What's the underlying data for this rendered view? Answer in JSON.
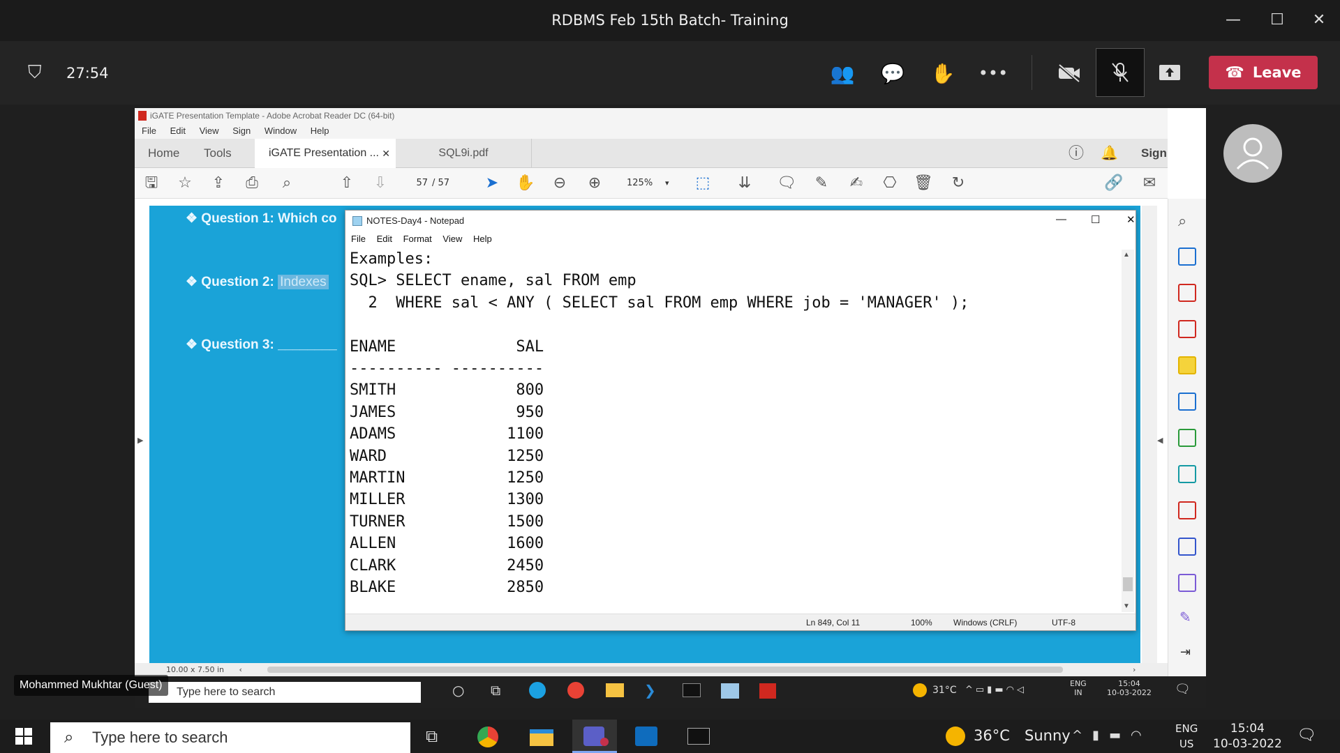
{
  "teams": {
    "window_title": "RDBMS Feb 15th Batch- Training",
    "timer": "27:54",
    "leave_label": "Leave"
  },
  "acrobat": {
    "title": "iGATE Presentation Template - Adobe Acrobat Reader DC (64-bit)",
    "menu": [
      "File",
      "Edit",
      "View",
      "Sign",
      "Window",
      "Help"
    ],
    "tabs": [
      "Home",
      "Tools",
      "iGATE Presentation ...",
      "SQL9i.pdf"
    ],
    "sign_label": "Sign",
    "page_current": "57",
    "page_total": "/ 57",
    "zoom": "125%",
    "page_size": "10.00 x 7.50 in"
  },
  "slide": {
    "q1": "❖ Question 1:  Which co",
    "q2_prefix": "❖ Question 2:",
    "q2_highlight": "Indexes",
    "q3": "❖ Question 3:  ________"
  },
  "notepad": {
    "title": "NOTES-Day4 - Notepad",
    "menu": [
      "File",
      "Edit",
      "Format",
      "View",
      "Help"
    ],
    "lines": [
      "Examples:",
      "SQL> SELECT ename, sal FROM emp",
      "  2  WHERE sal < ANY ( SELECT sal FROM emp WHERE job = 'MANAGER' );",
      "",
      "ENAME             SAL",
      "---------- ----------",
      "SMITH             800",
      "JAMES             950",
      "ADAMS            1100",
      "WARD             1250",
      "MARTIN           1250",
      "MILLER           1300",
      "TURNER           1500",
      "ALLEN            1600",
      "CLARK            2450",
      "BLAKE            2850"
    ],
    "status_pos": "Ln 849, Col 11",
    "status_zoom": "100%",
    "status_eol": "Windows (CRLF)",
    "status_enc": "UTF-8"
  },
  "participant": {
    "guest_name": "Mohammed Mukhtar (Guest)"
  },
  "shared_taskbar": {
    "search_placeholder": "Type here to search",
    "weather": "31°C",
    "lang1": "ENG",
    "lang2": "IN",
    "time": "15:04",
    "date": "10-03-2022"
  },
  "taskbar": {
    "search_placeholder": "Type here to search",
    "weather_temp": "36°C",
    "weather_desc": "Sunny",
    "lang1": "ENG",
    "lang2": "US",
    "time": "15:04",
    "date": "10-03-2022"
  }
}
